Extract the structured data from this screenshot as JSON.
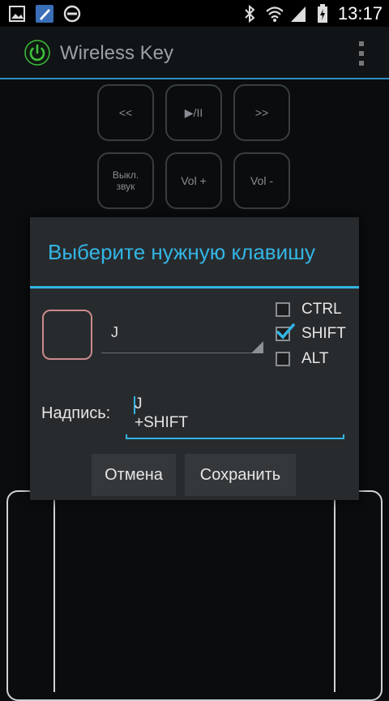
{
  "status_bar": {
    "time": "13:17",
    "left_icons": [
      "gallery-icon",
      "pen-app-icon",
      "do-not-disturb-icon"
    ],
    "right_icons": [
      "bluetooth-icon",
      "wifi-icon",
      "signal-icon",
      "battery-icon"
    ]
  },
  "app": {
    "title": "Wireless Key",
    "accent_color": "#33b5e5",
    "power_icon_color": "#3fbf3f"
  },
  "media_keys": {
    "row1": [
      "<<",
      "▶/II",
      ">>"
    ],
    "row2": [
      "Выкл. звук",
      "Vol +",
      "Vol -"
    ]
  },
  "dialog": {
    "title": "Выберите нужную клавишу",
    "selected_key": "J",
    "modifiers": [
      {
        "label": "CTRL",
        "checked": false
      },
      {
        "label": "SHIFT",
        "checked": true
      },
      {
        "label": "ALT",
        "checked": false
      }
    ],
    "caption_label": "Надпись:",
    "caption_line1": "J",
    "caption_line2": "+SHIFT",
    "cancel_label": "Отмена",
    "save_label": "Сохранить"
  }
}
